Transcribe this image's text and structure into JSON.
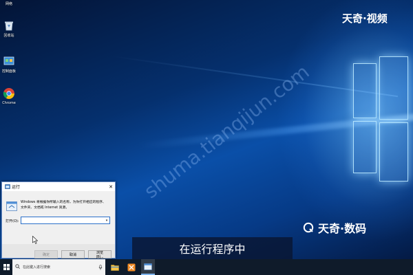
{
  "desktop": {
    "icons": [
      {
        "label": "网络",
        "icon": "network-icon"
      },
      {
        "label": "回收站",
        "icon": "recycle-bin-icon"
      },
      {
        "label": "控制面板",
        "icon": "control-panel-icon"
      },
      {
        "label": "Chrome",
        "icon": "chrome-icon"
      }
    ],
    "brand_top": "天奇·视频",
    "watermark": "shuma.tianqijun.com",
    "brand_bottom": "天奇·数码",
    "subtitle": "在运行程序中"
  },
  "run_dialog": {
    "title": "运行",
    "description": "Windows 将根据你所输入的名称，为你打开相应的程序、文件夹、文档或 Internet 资源。",
    "open_label": "打开(O):",
    "open_value": "",
    "ok_label": "确定",
    "cancel_label": "取消",
    "browse_label": "浏览(B)..."
  },
  "taskbar": {
    "search_placeholder": "在此键入进行搜索",
    "apps": [
      "file-explorer-icon",
      "app-orange-icon",
      "run-app-icon"
    ]
  },
  "colors": {
    "taskbar": "#0f1b2a",
    "dialog_border": "#6b8fc9",
    "input_border": "#2a6fc9",
    "wallpaper_light": "#5aa8f0"
  }
}
